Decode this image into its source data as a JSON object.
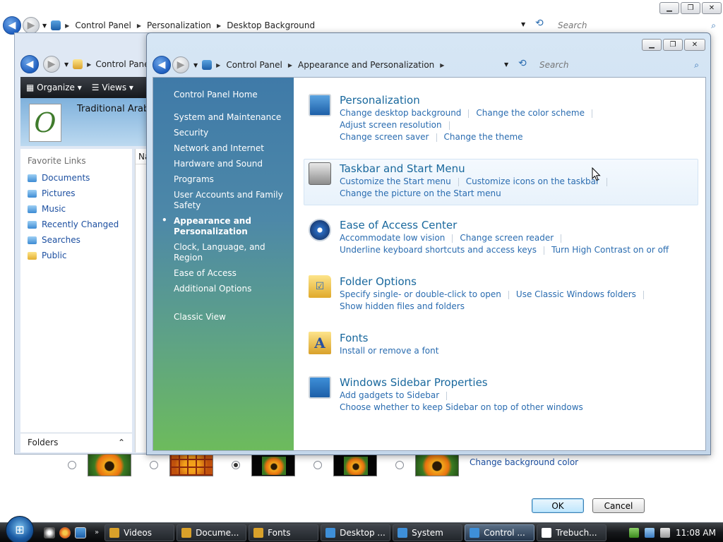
{
  "bg_window": {
    "breadcrumbs": [
      "Control Panel",
      "Personalization",
      "Desktop Background"
    ],
    "search_placeholder": "Search",
    "change_bg_color_link": "Change background color",
    "ok_label": "OK",
    "cancel_label": "Cancel",
    "selected_thumbnail_index": 2
  },
  "explorer": {
    "breadcrumb": "Control Pane",
    "toolbar": {
      "organize": "Organize",
      "views": "Views"
    },
    "font_name": "Traditional Arabic",
    "logo_glyph": "O",
    "favorite_links_heading": "Favorite Links",
    "favorite_links": [
      "Documents",
      "Pictures",
      "Music",
      "Recently Changed",
      "Searches",
      "Public"
    ],
    "column_header": "Na",
    "folders_label": "Folders"
  },
  "control_panel": {
    "breadcrumbs": [
      "Control Panel",
      "Appearance and Personalization"
    ],
    "search_placeholder": "Search",
    "nav": {
      "home": "Control Panel Home",
      "items": [
        "System and Maintenance",
        "Security",
        "Network and Internet",
        "Hardware and Sound",
        "Programs",
        "User Accounts and Family Safety",
        "Appearance and Personalization",
        "Clock, Language, and Region",
        "Ease of Access",
        "Additional Options"
      ],
      "active_index": 6,
      "classic": "Classic View"
    },
    "categories": [
      {
        "title": "Personalization",
        "icon": "monitor-icon",
        "link_lines": [
          [
            "Change desktop background",
            "Change the color scheme",
            "Adjust screen resolution"
          ],
          [
            "Change screen saver",
            "Change the theme"
          ]
        ]
      },
      {
        "title": "Taskbar and Start Menu",
        "icon": "taskbar-icon",
        "link_lines": [
          [
            "Customize the Start menu",
            "Customize icons on the taskbar"
          ],
          [
            "Change the picture on the Start menu"
          ]
        ]
      },
      {
        "title": "Ease of Access Center",
        "icon": "ease-of-access-icon",
        "link_lines": [
          [
            "Accommodate low vision",
            "Change screen reader"
          ],
          [
            "Underline keyboard shortcuts and access keys",
            "Turn High Contrast on or off"
          ]
        ]
      },
      {
        "title": "Folder Options",
        "icon": "folder-options-icon",
        "link_lines": [
          [
            "Specify single- or double-click to open",
            "Use Classic Windows folders"
          ],
          [
            "Show hidden files and folders"
          ]
        ]
      },
      {
        "title": "Fonts",
        "icon": "fonts-icon",
        "link_lines": [
          [
            "Install or remove a font"
          ]
        ]
      },
      {
        "title": "Windows Sidebar Properties",
        "icon": "sidebar-icon",
        "link_lines": [
          [
            "Add gadgets to Sidebar",
            "Choose whether to keep Sidebar on top of other windows"
          ]
        ]
      }
    ]
  },
  "taskbar": {
    "buttons": [
      {
        "label": "Videos",
        "color": "#d9a12a"
      },
      {
        "label": "Docume...",
        "color": "#d9a12a"
      },
      {
        "label": "Fonts",
        "color": "#d9a12a"
      },
      {
        "label": "Desktop ...",
        "color": "#3e8fd8"
      },
      {
        "label": "System",
        "color": "#3e8fd8"
      },
      {
        "label": "Control ...",
        "color": "#3e8fd8"
      },
      {
        "label": "Trebuch...",
        "color": "#ffffff"
      }
    ],
    "active_index": 5,
    "clock": "11:08 AM"
  }
}
